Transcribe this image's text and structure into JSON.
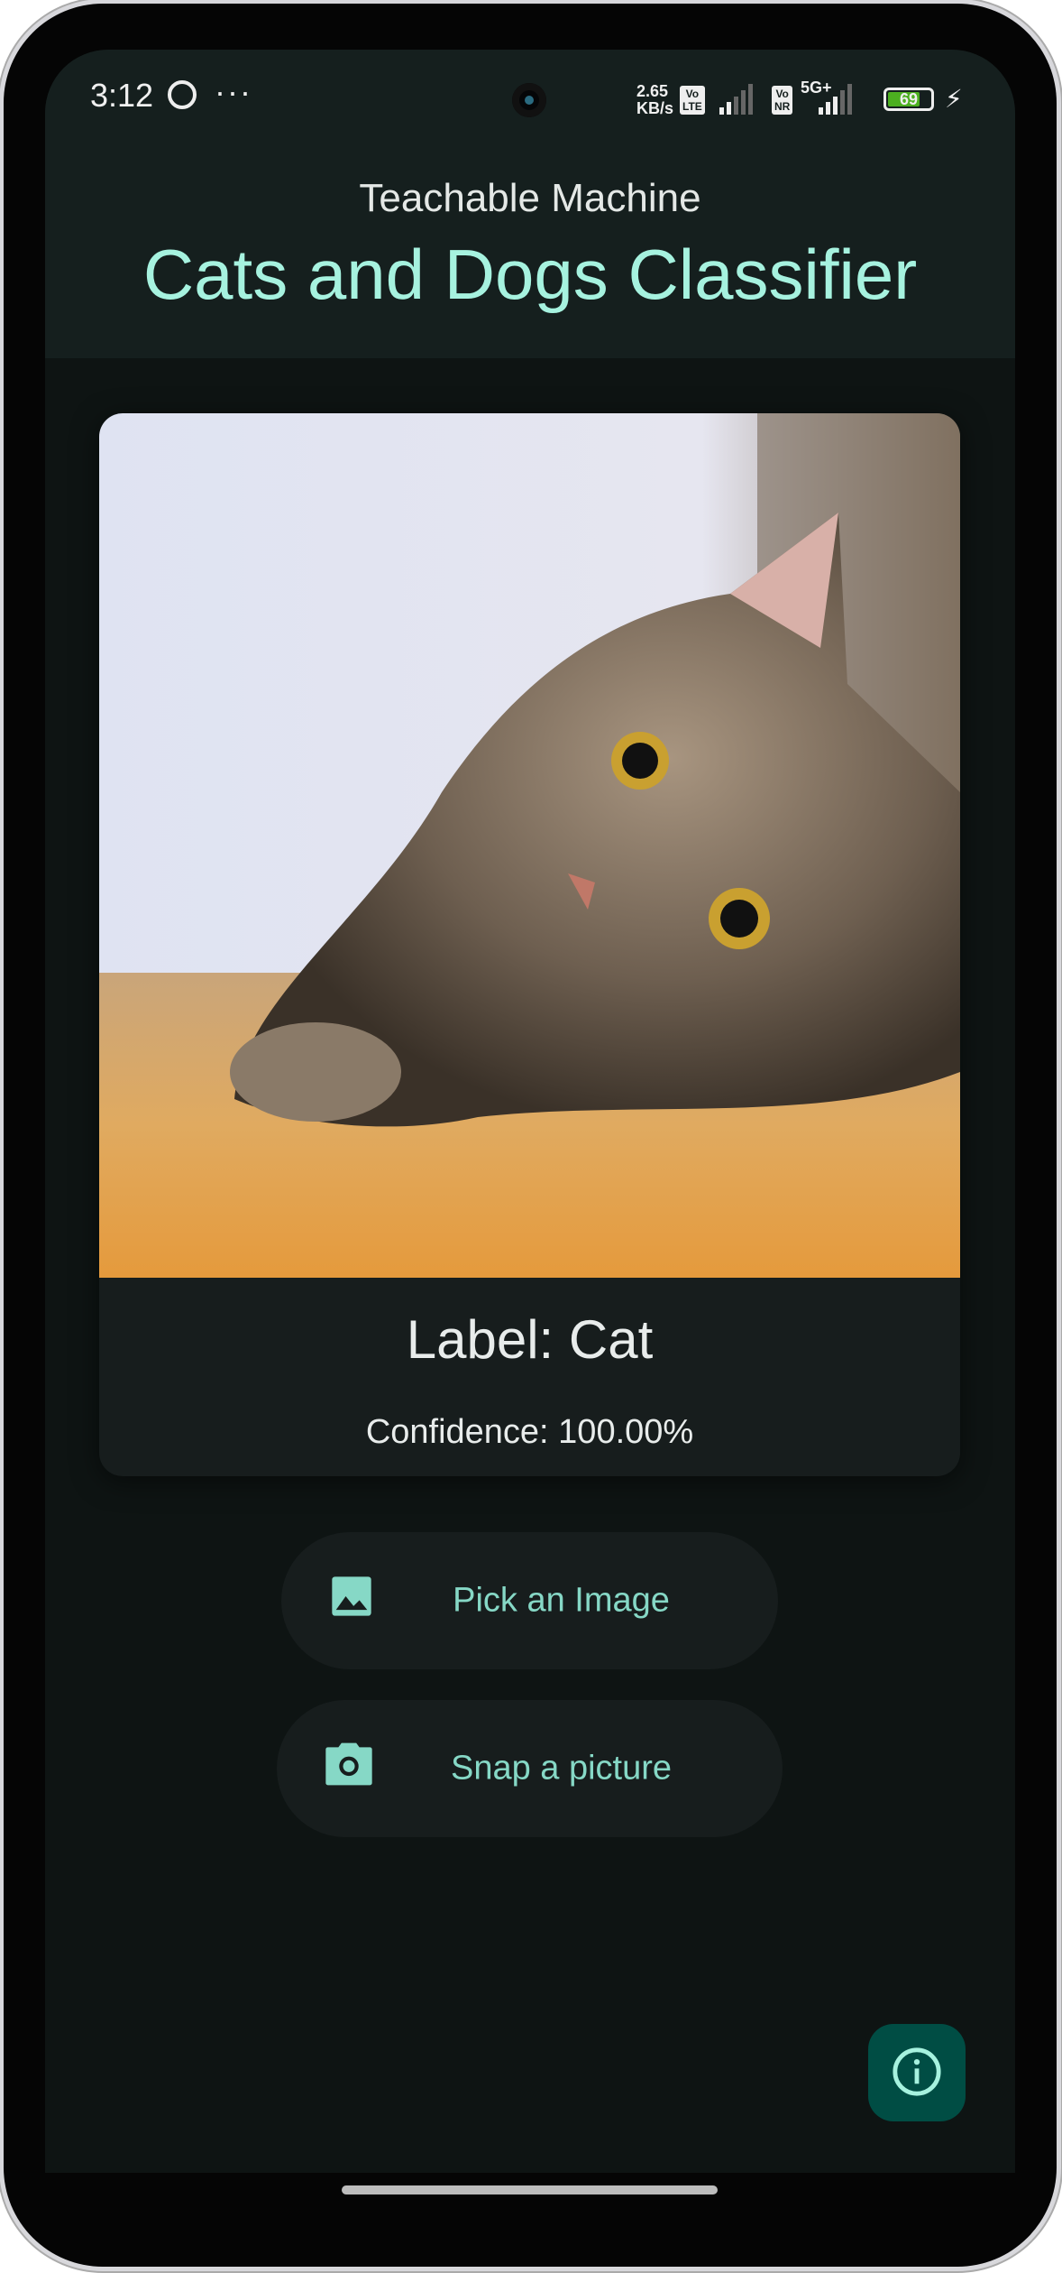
{
  "status_bar": {
    "time": "3:12",
    "overflow": "···",
    "net_speed_value": "2.65",
    "net_speed_unit": "KB/s",
    "volte1_top": "Vo",
    "volte1_bottom": "LTE",
    "volte2_top": "Vo",
    "volte2_bottom": "NR",
    "network_type": "5G+",
    "battery": "69",
    "battery_level_percent": 69,
    "battery_color": "#4caf20"
  },
  "header": {
    "subtitle": "Teachable Machine",
    "title": "Cats and Dogs Classifier"
  },
  "result": {
    "image_icon": "cat-photo",
    "label": "Label: Cat",
    "confidence": "Confidence: 100.00%"
  },
  "actions": [
    {
      "label": "Pick an Image",
      "icon": "image-icon"
    },
    {
      "label": "Snap a picture",
      "icon": "camera-icon"
    }
  ],
  "fab": {
    "icon": "info-icon",
    "color": "#004d44"
  },
  "colors": {
    "accent": "#a6f2df",
    "button_text": "#86d8c6",
    "background": "#0e1413",
    "header": "#151f1e"
  }
}
